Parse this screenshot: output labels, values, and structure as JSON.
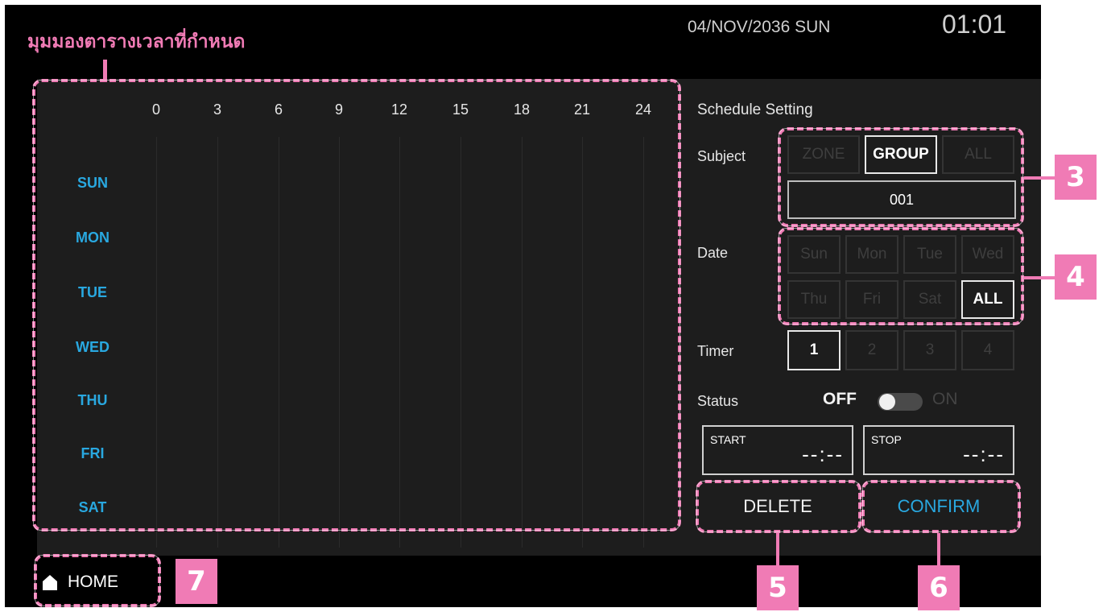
{
  "header": {
    "date": "04/NOV/2036  SUN",
    "time": "01:01"
  },
  "callout_title": "มุมมองตารางเวลาที่กำหนด",
  "grid": {
    "hours": [
      "0",
      "3",
      "6",
      "9",
      "12",
      "15",
      "18",
      "21",
      "24"
    ],
    "days": [
      "SUN",
      "MON",
      "TUE",
      "WED",
      "THU",
      "FRI",
      "SAT"
    ]
  },
  "schedule": {
    "title": "Schedule Setting",
    "subject_label": "Subject",
    "subject_options": [
      "ZONE",
      "GROUP",
      "ALL"
    ],
    "subject_selected": "GROUP",
    "subject_value": "001",
    "date_label": "Date",
    "date_options_row1": [
      "Sun",
      "Mon",
      "Tue",
      "Wed"
    ],
    "date_options_row2": [
      "Thu",
      "Fri",
      "Sat",
      "ALL"
    ],
    "date_selected": "ALL",
    "timer_label": "Timer",
    "timer_options": [
      "1",
      "2",
      "3",
      "4"
    ],
    "timer_selected": "1",
    "status_label": "Status",
    "status_off": "OFF",
    "status_on": "ON",
    "start_label": "START",
    "start_value": "--:--",
    "stop_label": "STOP",
    "stop_value": "--:--"
  },
  "actions": {
    "delete": "DELETE",
    "confirm": "CONFIRM"
  },
  "home": {
    "label": "HOME",
    "icon": "home-icon"
  },
  "badges": {
    "b3": "3",
    "b4": "4",
    "b5": "5",
    "b6": "6",
    "b7": "7"
  },
  "colors": {
    "accent": "#29a8e0",
    "annotation": "#f07bb5",
    "background": "#000000",
    "panel": "#1d1d1d"
  }
}
